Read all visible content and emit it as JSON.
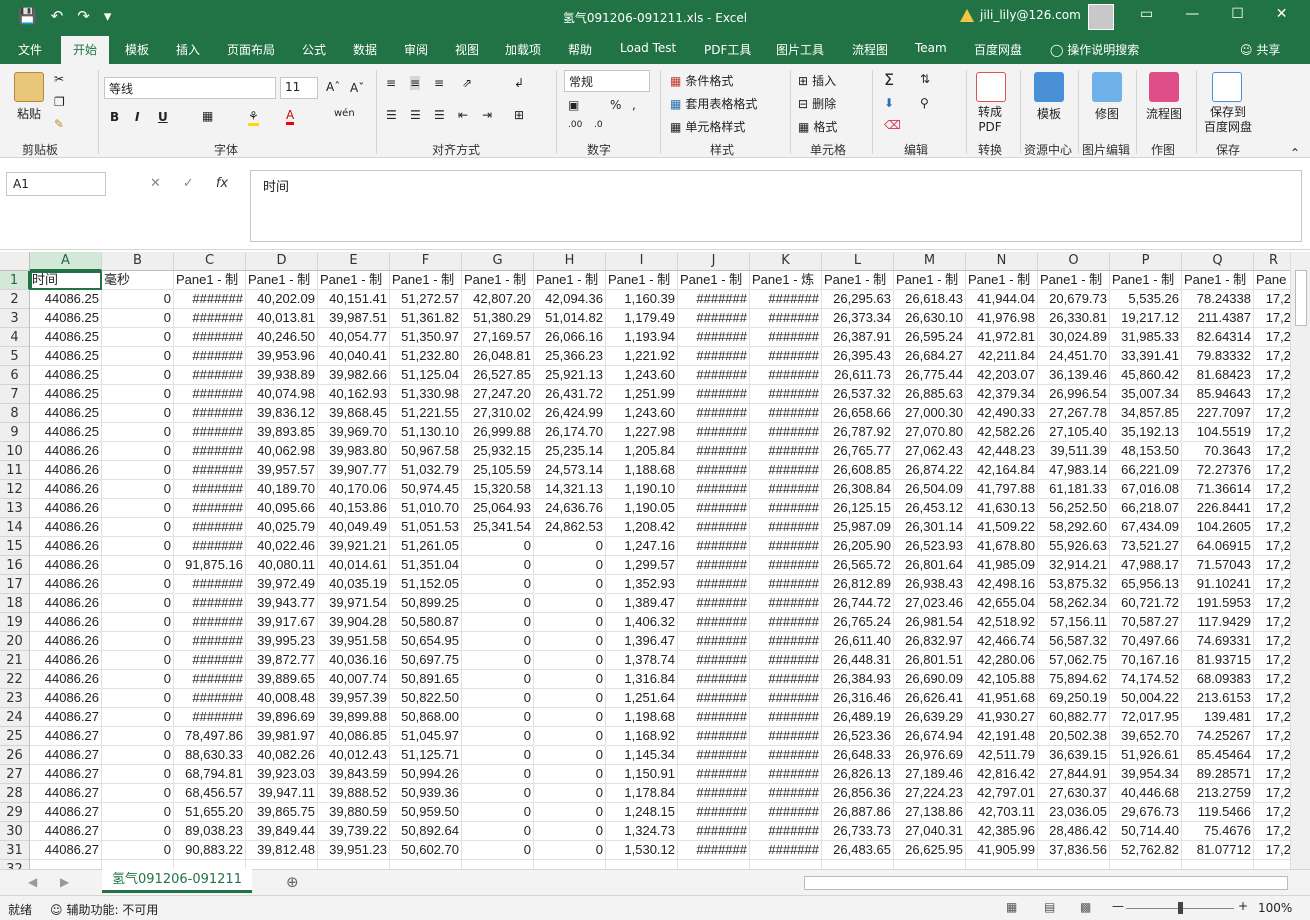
{
  "window": {
    "title": "氢气091206-091211.xls  -  Excel",
    "user": "jili_lily@126.com"
  },
  "tabs": [
    "文件",
    "开始",
    "模板",
    "插入",
    "页面布局",
    "公式",
    "数据",
    "审阅",
    "视图",
    "加载项",
    "帮助",
    "Load Test",
    "PDF工具",
    "图片工具",
    "流程图",
    "Team",
    "百度网盘"
  ],
  "tell_me": "操作说明搜索",
  "share": "共享",
  "ribbon": {
    "paste": "粘贴",
    "clipboard": "剪贴板",
    "font_name": "等线",
    "font_size": "11",
    "font_group": "字体",
    "align_group": "对齐方式",
    "number_format": "常规",
    "number_group": "数字",
    "cond_format": "条件格式",
    "table_format": "套用表格格式",
    "cell_style": "单元格样式",
    "styles_group": "样式",
    "insert": "插入",
    "delete": "删除",
    "format": "格式",
    "cells_group": "单元格",
    "edit_group": "编辑",
    "to_pdf": "转成\nPDF",
    "convert_group": "转换",
    "template": "模板",
    "resource_group": "资源中心",
    "fix_image": "修图",
    "image_group": "图片编辑",
    "flowchart": "流程图",
    "draw_group": "作图",
    "save_baidu": "保存到\n百度网盘",
    "save_group": "保存"
  },
  "formula_bar": {
    "name_box": "A1",
    "content": "时间"
  },
  "columns": [
    "A",
    "B",
    "C",
    "D",
    "E",
    "F",
    "G",
    "H",
    "I",
    "J",
    "K",
    "L",
    "M",
    "N",
    "O",
    "P",
    "Q",
    "R"
  ],
  "header_row": [
    "时间",
    "毫秒",
    "Pane1 - 制",
    "Pane1 - 制",
    "Pane1 - 制",
    "Pane1 - 制",
    "Pane1 - 制",
    "Pane1 - 制",
    "Pane1 - 制",
    "Pane1 - 制",
    "Pane1 - 炼",
    "Pane1 - 制",
    "Pane1 - 制",
    "Pane1 - 制",
    "Pane1 - 制",
    "Pane1 - 制",
    "Pane1 - 制",
    "Pane"
  ],
  "rows": [
    [
      "44086.25",
      "0",
      "#######",
      "40,202.09",
      "40,151.41",
      "51,272.57",
      "42,807.20",
      "42,094.36",
      "1,160.39",
      "#######",
      "#######",
      "26,295.63",
      "26,618.43",
      "41,944.04",
      "20,679.73",
      "5,535.26",
      "78.24338",
      "17,2"
    ],
    [
      "44086.25",
      "0",
      "#######",
      "40,013.81",
      "39,987.51",
      "51,361.82",
      "51,380.29",
      "51,014.82",
      "1,179.49",
      "#######",
      "#######",
      "26,373.34",
      "26,630.10",
      "41,976.98",
      "26,330.81",
      "19,217.12",
      "211.4387",
      "17,2"
    ],
    [
      "44086.25",
      "0",
      "#######",
      "40,246.50",
      "40,054.77",
      "51,350.97",
      "27,169.57",
      "26,066.16",
      "1,193.94",
      "#######",
      "#######",
      "26,387.91",
      "26,595.24",
      "41,972.81",
      "30,024.89",
      "31,985.33",
      "82.64314",
      "17,2"
    ],
    [
      "44086.25",
      "0",
      "#######",
      "39,953.96",
      "40,040.41",
      "51,232.80",
      "26,048.81",
      "25,366.23",
      "1,221.92",
      "#######",
      "#######",
      "26,395.43",
      "26,684.27",
      "42,211.84",
      "24,451.70",
      "33,391.41",
      "79.83332",
      "17,2"
    ],
    [
      "44086.25",
      "0",
      "#######",
      "39,938.89",
      "39,982.66",
      "51,125.04",
      "26,527.85",
      "25,921.13",
      "1,243.60",
      "#######",
      "#######",
      "26,611.73",
      "26,775.44",
      "42,203.07",
      "36,139.46",
      "45,860.42",
      "81.68423",
      "17,2"
    ],
    [
      "44086.25",
      "0",
      "#######",
      "40,074.98",
      "40,162.93",
      "51,330.98",
      "27,247.20",
      "26,431.72",
      "1,251.99",
      "#######",
      "#######",
      "26,537.32",
      "26,885.63",
      "42,379.34",
      "26,996.54",
      "35,007.34",
      "85.94643",
      "17,2"
    ],
    [
      "44086.25",
      "0",
      "#######",
      "39,836.12",
      "39,868.45",
      "51,221.55",
      "27,310.02",
      "26,424.99",
      "1,243.60",
      "#######",
      "#######",
      "26,658.66",
      "27,000.30",
      "42,490.33",
      "27,267.78",
      "34,857.85",
      "227.7097",
      "17,2"
    ],
    [
      "44086.25",
      "0",
      "#######",
      "39,893.85",
      "39,969.70",
      "51,130.10",
      "26,999.88",
      "26,174.70",
      "1,227.98",
      "#######",
      "#######",
      "26,787.92",
      "27,070.80",
      "42,582.26",
      "27,105.40",
      "35,192.13",
      "104.5519",
      "17,2"
    ],
    [
      "44086.26",
      "0",
      "#######",
      "40,062.98",
      "39,983.80",
      "50,967.58",
      "25,932.15",
      "25,235.14",
      "1,205.84",
      "#######",
      "#######",
      "26,765.77",
      "27,062.43",
      "42,448.23",
      "39,511.39",
      "48,153.50",
      "70.3643",
      "17,2"
    ],
    [
      "44086.26",
      "0",
      "#######",
      "39,957.57",
      "39,907.77",
      "51,032.79",
      "25,105.59",
      "24,573.14",
      "1,188.68",
      "#######",
      "#######",
      "26,608.85",
      "26,874.22",
      "42,164.84",
      "47,983.14",
      "66,221.09",
      "72.27376",
      "17,2"
    ],
    [
      "44086.26",
      "0",
      "#######",
      "40,189.70",
      "40,170.06",
      "50,974.45",
      "15,320.58",
      "14,321.13",
      "1,190.10",
      "#######",
      "#######",
      "26,308.84",
      "26,504.09",
      "41,797.88",
      "61,181.33",
      "67,016.08",
      "71.36614",
      "17,2"
    ],
    [
      "44086.26",
      "0",
      "#######",
      "40,095.66",
      "40,153.86",
      "51,010.70",
      "25,064.93",
      "24,636.76",
      "1,190.05",
      "#######",
      "#######",
      "26,125.15",
      "26,453.12",
      "41,630.13",
      "56,252.50",
      "66,218.07",
      "226.8441",
      "17,2"
    ],
    [
      "44086.26",
      "0",
      "#######",
      "40,025.79",
      "40,049.49",
      "51,051.53",
      "25,341.54",
      "24,862.53",
      "1,208.42",
      "#######",
      "#######",
      "25,987.09",
      "26,301.14",
      "41,509.22",
      "58,292.60",
      "67,434.09",
      "104.2605",
      "17,2"
    ],
    [
      "44086.26",
      "0",
      "#######",
      "40,022.46",
      "39,921.21",
      "51,261.05",
      "0",
      "0",
      "1,247.16",
      "#######",
      "#######",
      "26,205.90",
      "26,523.93",
      "41,678.80",
      "55,926.63",
      "73,521.27",
      "64.06915",
      "17,2"
    ],
    [
      "44086.26",
      "0",
      "91,875.16",
      "40,080.11",
      "40,014.61",
      "51,351.04",
      "0",
      "0",
      "1,299.57",
      "#######",
      "#######",
      "26,565.72",
      "26,801.64",
      "41,985.09",
      "32,914.21",
      "47,988.17",
      "71.57043",
      "17,2"
    ],
    [
      "44086.26",
      "0",
      "#######",
      "39,972.49",
      "40,035.19",
      "51,152.05",
      "0",
      "0",
      "1,352.93",
      "#######",
      "#######",
      "26,812.89",
      "26,938.43",
      "42,498.16",
      "53,875.32",
      "65,956.13",
      "91.10241",
      "17,2"
    ],
    [
      "44086.26",
      "0",
      "#######",
      "39,943.77",
      "39,971.54",
      "50,899.25",
      "0",
      "0",
      "1,389.47",
      "#######",
      "#######",
      "26,744.72",
      "27,023.46",
      "42,655.04",
      "58,262.34",
      "60,721.72",
      "191.5953",
      "17,2"
    ],
    [
      "44086.26",
      "0",
      "#######",
      "39,917.67",
      "39,904.28",
      "50,580.87",
      "0",
      "0",
      "1,406.32",
      "#######",
      "#######",
      "26,765.24",
      "26,981.54",
      "42,518.92",
      "57,156.11",
      "70,587.27",
      "117.9429",
      "17,2"
    ],
    [
      "44086.26",
      "0",
      "#######",
      "39,995.23",
      "39,951.58",
      "50,654.95",
      "0",
      "0",
      "1,396.47",
      "#######",
      "#######",
      "26,611.40",
      "26,832.97",
      "42,466.74",
      "56,587.32",
      "70,497.66",
      "74.69331",
      "17,2"
    ],
    [
      "44086.26",
      "0",
      "#######",
      "39,872.77",
      "40,036.16",
      "50,697.75",
      "0",
      "0",
      "1,378.74",
      "#######",
      "#######",
      "26,448.31",
      "26,801.51",
      "42,280.06",
      "57,062.75",
      "70,167.16",
      "81.93715",
      "17,2"
    ],
    [
      "44086.26",
      "0",
      "#######",
      "39,889.65",
      "40,007.74",
      "50,891.65",
      "0",
      "0",
      "1,316.84",
      "#######",
      "#######",
      "26,384.93",
      "26,690.09",
      "42,105.88",
      "75,894.62",
      "74,174.52",
      "68.09383",
      "17,2"
    ],
    [
      "44086.26",
      "0",
      "#######",
      "40,008.48",
      "39,957.39",
      "50,822.50",
      "0",
      "0",
      "1,251.64",
      "#######",
      "#######",
      "26,316.46",
      "26,626.41",
      "41,951.68",
      "69,250.19",
      "50,004.22",
      "213.6153",
      "17,2"
    ],
    [
      "44086.27",
      "0",
      "#######",
      "39,896.69",
      "39,899.88",
      "50,868.00",
      "0",
      "0",
      "1,198.68",
      "#######",
      "#######",
      "26,489.19",
      "26,639.29",
      "41,930.27",
      "60,882.77",
      "72,017.95",
      "139.481",
      "17,2"
    ],
    [
      "44086.27",
      "0",
      "78,497.86",
      "39,981.97",
      "40,086.85",
      "51,045.97",
      "0",
      "0",
      "1,168.92",
      "#######",
      "#######",
      "26,523.36",
      "26,674.94",
      "42,191.48",
      "20,502.38",
      "39,652.70",
      "74.25267",
      "17,2"
    ],
    [
      "44086.27",
      "0",
      "88,630.33",
      "40,082.26",
      "40,012.43",
      "51,125.71",
      "0",
      "0",
      "1,145.34",
      "#######",
      "#######",
      "26,648.33",
      "26,976.69",
      "42,511.79",
      "36,639.15",
      "51,926.61",
      "85.45464",
      "17,2"
    ],
    [
      "44086.27",
      "0",
      "68,794.81",
      "39,923.03",
      "39,843.59",
      "50,994.26",
      "0",
      "0",
      "1,150.91",
      "#######",
      "#######",
      "26,826.13",
      "27,189.46",
      "42,816.42",
      "27,844.91",
      "39,954.34",
      "89.28571",
      "17,2"
    ],
    [
      "44086.27",
      "0",
      "68,456.57",
      "39,947.11",
      "39,888.52",
      "50,939.36",
      "0",
      "0",
      "1,178.84",
      "#######",
      "#######",
      "26,856.36",
      "27,224.23",
      "42,797.01",
      "27,630.37",
      "40,446.68",
      "213.2759",
      "17,2"
    ],
    [
      "44086.27",
      "0",
      "51,655.20",
      "39,865.75",
      "39,880.59",
      "50,959.50",
      "0",
      "0",
      "1,248.15",
      "#######",
      "#######",
      "26,887.86",
      "27,138.86",
      "42,703.11",
      "23,036.05",
      "29,676.73",
      "119.5466",
      "17,2"
    ],
    [
      "44086.27",
      "0",
      "89,038.23",
      "39,849.44",
      "39,739.22",
      "50,892.64",
      "0",
      "0",
      "1,324.73",
      "#######",
      "#######",
      "26,733.73",
      "27,040.31",
      "42,385.96",
      "28,486.42",
      "50,714.40",
      "75.4676",
      "17,2"
    ],
    [
      "44086.27",
      "0",
      "90,883.22",
      "39,812.48",
      "39,951.23",
      "50,602.70",
      "0",
      "0",
      "1,530.12",
      "#######",
      "#######",
      "26,483.65",
      "26,625.95",
      "41,905.99",
      "37,836.56",
      "52,762.82",
      "81.07712",
      "17,2"
    ]
  ],
  "sheet_tab": "氢气091206-091211",
  "status": {
    "ready": "就绪",
    "accessibility": "辅助功能: 不可用",
    "zoom": "100%"
  }
}
